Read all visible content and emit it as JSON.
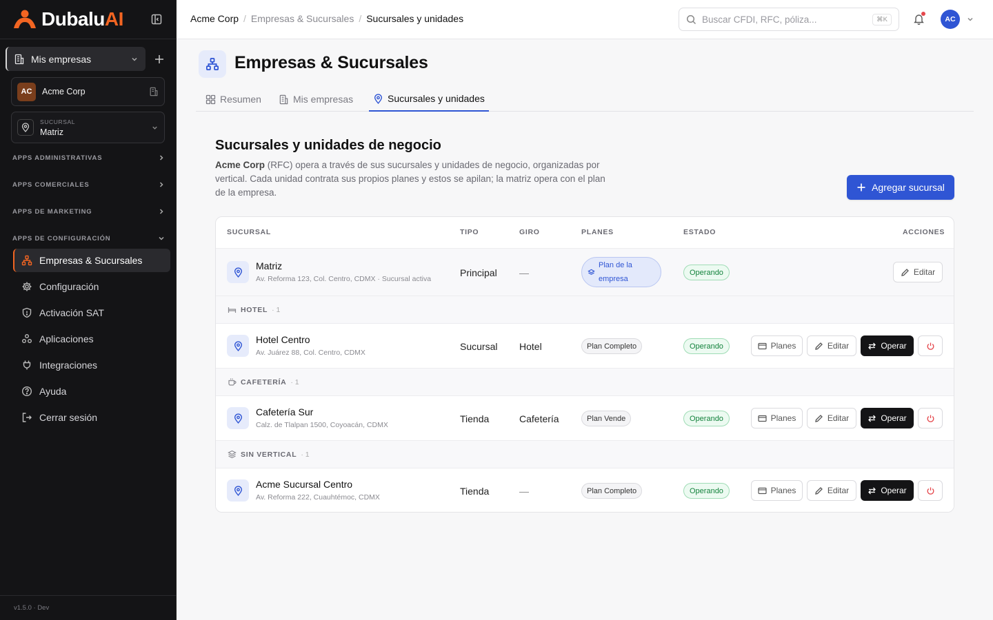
{
  "brand": {
    "name": "Dubalu",
    "suffix": "AI"
  },
  "sidebar": {
    "workspace_label": "Mis empresas",
    "company": {
      "initials": "AC",
      "name": "Acme Corp"
    },
    "branch": {
      "caption": "SUCURSAL",
      "value": "Matriz"
    },
    "sections": [
      {
        "label": "APPS ADMINISTRATIVAS"
      },
      {
        "label": "APPS COMERCIALES"
      },
      {
        "label": "APPS DE MARKETING"
      },
      {
        "label": "APPS DE CONFIGURACIÓN"
      }
    ],
    "items": [
      {
        "label": "Empresas & Sucursales",
        "icon": "org-chart-icon"
      },
      {
        "label": "Configuración",
        "icon": "gear-icon"
      },
      {
        "label": "Activación SAT",
        "icon": "shield-icon"
      },
      {
        "label": "Aplicaciones",
        "icon": "apps-icon"
      },
      {
        "label": "Integraciones",
        "icon": "plug-icon"
      },
      {
        "label": "Ayuda",
        "icon": "help-icon"
      },
      {
        "label": "Cerrar sesión",
        "icon": "logout-icon"
      }
    ],
    "version": "v1.5.0 · Dev"
  },
  "topbar": {
    "breadcrumbs": [
      "Acme Corp",
      "Empresas & Sucursales",
      "Sucursales y unidades"
    ],
    "search_placeholder": "Buscar CFDI, RFC, póliza...",
    "search_shortcut": "⌘K",
    "avatar_initials": "AC"
  },
  "page": {
    "title": "Empresas & Sucursales",
    "tabs": [
      {
        "label": "Resumen"
      },
      {
        "label": "Mis empresas"
      },
      {
        "label": "Sucursales y unidades"
      }
    ]
  },
  "section": {
    "title": "Sucursales y unidades de negocio",
    "desc_company": "Acme Corp",
    "desc_rest": " (RFC) opera a través de sus sucursales y unidades de negocio, organizadas por vertical. Cada unidad contrata sus propios planes y estos se apilan; la matriz opera con el plan de la empresa.",
    "add_button": "Agregar sucursal"
  },
  "table": {
    "headers": {
      "branch": "SUCURSAL",
      "type": "TIPO",
      "line": "GIRO",
      "plans": "PLANES",
      "status": "ESTADO",
      "actions": "ACCIONES"
    },
    "main_row": {
      "name": "Matriz",
      "address": "Av. Reforma 123, Col. Centro, CDMX · Sucursal activa",
      "type": "Principal",
      "line": "—",
      "plan": "Plan de la empresa",
      "status": "Operando",
      "edit": "Editar"
    },
    "groups": [
      {
        "label": "HOTEL",
        "count": "· 1",
        "icon": "bed-icon",
        "row": {
          "name": "Hotel Centro",
          "address": "Av. Juárez 88, Col. Centro, CDMX",
          "type": "Sucursal",
          "line": "Hotel",
          "plan": "Plan Completo",
          "status": "Operando"
        }
      },
      {
        "label": "CAFETERÍA",
        "count": "· 1",
        "icon": "coffee-icon",
        "row": {
          "name": "Cafetería Sur",
          "address": "Calz. de Tlalpan 1500, Coyoacán, CDMX",
          "type": "Tienda",
          "line": "Cafetería",
          "plan": "Plan Vende",
          "status": "Operando"
        }
      },
      {
        "label": "SIN VERTICAL",
        "count": "· 1",
        "icon": "layers-icon",
        "row": {
          "name": "Acme Sucursal Centro",
          "address": "Av. Reforma 222, Cuauhtémoc, CDMX",
          "type": "Tienda",
          "line": "—",
          "plan": "Plan Completo",
          "status": "Operando"
        }
      }
    ],
    "actions": {
      "plans": "Planes",
      "edit": "Editar",
      "operate": "Operar"
    }
  },
  "colors": {
    "accent": "#2f55d4",
    "brand_orange": "#f26522",
    "sidebar_bg": "#141416",
    "success": "#14833d",
    "danger": "#e5484d"
  }
}
